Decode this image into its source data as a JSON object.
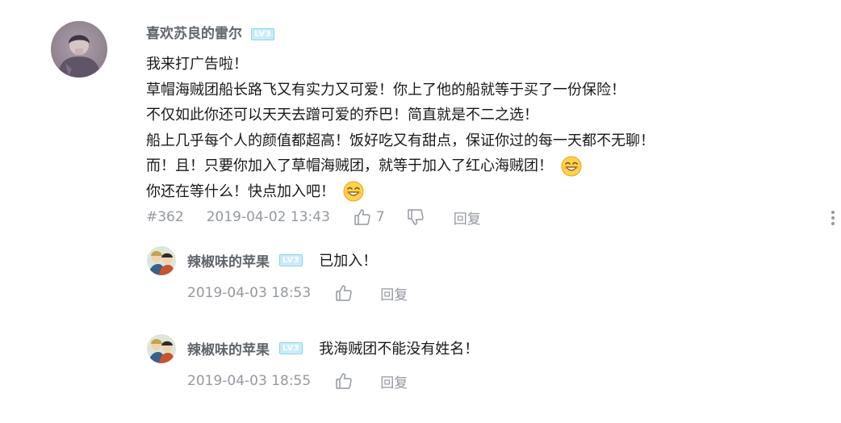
{
  "main_comment": {
    "username": "喜欢苏良的雷尔",
    "level": "LV3",
    "lines": [
      "我来打广告啦！",
      "草帽海贼团船长路飞又有实力又可爱！你上了他的船就等于买了一份保险！",
      "不仅如此你还可以天天去蹭可爱的乔巴！简直就是不二之选！",
      "船上几乎每个人的颜值都超高！饭好吃又有甜点，保证你过的每一天都不无聊！",
      "而！且！只要你加入了草帽海贼团，就等于加入了红心海贼团！",
      "你还在等什么！快点加入吧！"
    ],
    "floor": "#362",
    "time": "2019-04-02 13:43",
    "likes": "7",
    "reply_label": "回复",
    "emoji_icon": "smiling-face-emoji"
  },
  "replies": [
    {
      "username": "辣椒味的苹果",
      "level": "LV3",
      "text": "已加入！",
      "time": "2019-04-03 18:53",
      "reply_label": "回复"
    },
    {
      "username": "辣椒味的苹果",
      "level": "LV3",
      "text": "我海贼团不能没有姓名！",
      "time": "2019-04-03 18:55",
      "reply_label": "回复"
    }
  ],
  "colors": {
    "username": "#61666d",
    "body_text": "#18191c",
    "meta_text": "#9499a0",
    "level_badge": "#c9ecfa"
  },
  "icons": {
    "like": "thumbs-up-icon",
    "dislike": "thumbs-down-icon",
    "more": "more-vertical-icon"
  }
}
